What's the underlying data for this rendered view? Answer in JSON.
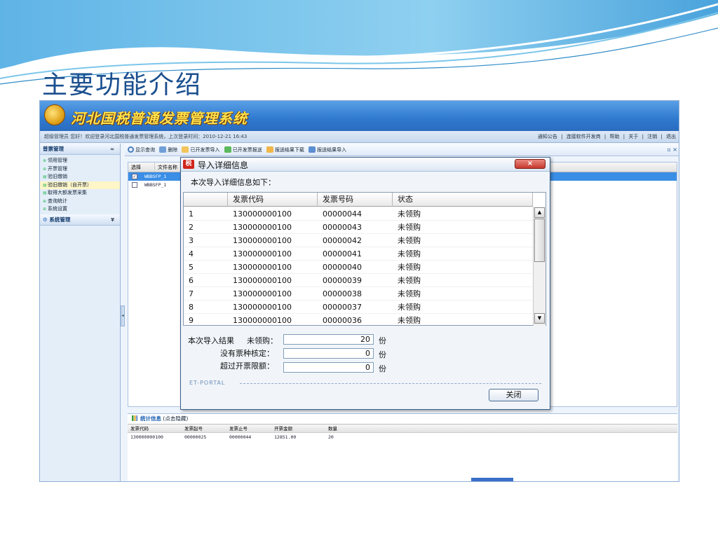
{
  "slide": {
    "title": "主要功能介绍"
  },
  "app": {
    "name": "河北国税普通发票管理系统",
    "info_bar": "超级管理员 您好！欢迎登录河北国税普通发票管理系统，上次登录时间：2010-12-21 16:43",
    "top_links": [
      "通知公告",
      "|",
      "连接软件开发商",
      "|",
      "帮助",
      "|",
      "关于",
      "|",
      "注销",
      "|",
      "退出"
    ]
  },
  "sidebar": {
    "section1": {
      "label": "普票管理",
      "chevron": "≈"
    },
    "items": [
      {
        "label": "领用管理",
        "bullet": "⊕"
      },
      {
        "label": "开票管理",
        "bullet": "⊕"
      },
      {
        "label": "验旧缴销",
        "bullet": "▤"
      },
      {
        "label": "验旧缴销（自开票）",
        "bullet": "▤"
      },
      {
        "label": "取得大额发票采集",
        "bullet": "▤"
      },
      {
        "label": "查询统计",
        "bullet": "⊕"
      },
      {
        "label": "系统设置",
        "bullet": "⊕"
      }
    ],
    "section2": {
      "label": "系统管理",
      "chevron": "¥"
    },
    "collapse": "◂"
  },
  "toolbar": {
    "items": [
      "显示查询",
      "删除",
      "已开发票导入",
      "已开发票报送",
      "报送结果下载",
      "报送结果导入"
    ],
    "window_controls": "▫ ×"
  },
  "file_list": {
    "headers": [
      "选择",
      "文件名称"
    ],
    "rows": [
      {
        "checked": true,
        "name": "WBBSFP_1"
      },
      {
        "checked": false,
        "name": "WBBSFP_1"
      }
    ]
  },
  "dialog": {
    "title": "导入详细信息",
    "icon_text": "税",
    "close_x": "×",
    "subtitle": "本次导入详细信息如下：",
    "columns": [
      "",
      "发票代码",
      "发票号码",
      "状态"
    ],
    "rows": [
      [
        "1",
        "130000000100",
        "00000044",
        "未领购"
      ],
      [
        "2",
        "130000000100",
        "00000043",
        "未领购"
      ],
      [
        "3",
        "130000000100",
        "00000042",
        "未领购"
      ],
      [
        "4",
        "130000000100",
        "00000041",
        "未领购"
      ],
      [
        "5",
        "130000000100",
        "00000040",
        "未领购"
      ],
      [
        "6",
        "130000000100",
        "00000039",
        "未领购"
      ],
      [
        "7",
        "130000000100",
        "00000038",
        "未领购"
      ],
      [
        "8",
        "130000000100",
        "00000037",
        "未领购"
      ],
      [
        "9",
        "130000000100",
        "00000036",
        "未领购"
      ]
    ],
    "scroll_up": "▲",
    "scroll_down": "▼",
    "result_title": "本次导入结果",
    "result_rows": [
      {
        "label": "未领购：",
        "value": "20",
        "unit": "份"
      },
      {
        "label": "没有票种核定：",
        "value": "0",
        "unit": "份"
      },
      {
        "label": "超过开票限额：",
        "value": "0",
        "unit": "份"
      }
    ],
    "brand": "ET-PORTAL",
    "close_button": "关闭"
  },
  "stats": {
    "title": "统计信息",
    "hint": "(点击隐藏)",
    "headers": [
      "发票代码",
      "发票起号",
      "发票止号",
      "开票金额",
      "数量"
    ],
    "row": [
      "130000000100",
      "00000025",
      "00000044",
      "12851.00",
      "20"
    ]
  },
  "colors": {
    "title": "#1b4f8f",
    "banner": "#2f79cf",
    "selection": "#3a8ee6",
    "close_red": "#c6382c"
  }
}
